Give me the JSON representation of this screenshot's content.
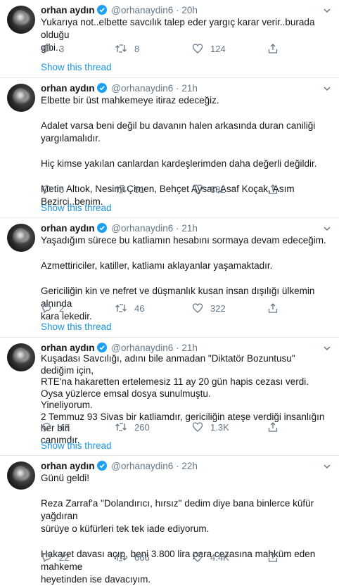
{
  "tweets": [
    {
      "name": "orhan aydın",
      "handle": "@orhanaydin6",
      "time": "20h",
      "lines": [
        "Yukarıya not..elbette savcılık talep eder yargıç karar verir..burada olduğu",
        "gibi.."
      ],
      "replies": "3",
      "retweets": "8",
      "likes": "124",
      "show_thread": "Show this thread"
    },
    {
      "name": "orhan aydın",
      "handle": "@orhanaydin6",
      "time": "21h",
      "lines": [
        "Elbette bir üst mahkemeye itiraz edeceğiz.",
        "",
        "Adalet varsa beni değil bu davanın halen arkasında duran caniliği",
        "yargılamalıdır.",
        "",
        "Hiç kimse yakılan canlardan kardeşlerimden daha değerli değildir.",
        "",
        "Metin Altıok, Nesimi Çimen, Behçet Aysan,Asaf Koçak, Asım Bezirci..benim."
      ],
      "replies": "6",
      "retweets": "51",
      "likes": "382",
      "show_thread": "Show this thread"
    },
    {
      "name": "orhan aydın",
      "handle": "@orhanaydin6",
      "time": "21h",
      "lines": [
        "Yaşadığım sürece bu katliamın hesabını sormaya devam edeceğim.",
        "",
        "Azmettiriciler, katiller, katliamı aklayanlar yaşamaktadır.",
        "",
        "Gericiliğin kin ve nefret ve düşmanlık kusan insan dışılığı ülkemin alnında",
        "kara lekedir."
      ],
      "replies": "2",
      "retweets": "46",
      "likes": "322",
      "show_thread": "Show this thread"
    },
    {
      "name": "orhan aydın",
      "handle": "@orhanaydin6",
      "time": "21h",
      "lines": [
        "Kuşadası Savcılığı, adını bile anmadan \"Diktatör Bozuntusu\" dediğim için,",
        "RTE'na hakaretten ertelemesiz 11 ay 20 gün hapis cezası verdi.",
        "Oysa yüzlerce emsal dosya sunulmuştu.",
        "Yineliyorum.",
        "2 Temmuz 93 Sivas bir katliamdır, gericiliğin ateşe verdiği insanlığın her biri",
        "canımdır."
      ],
      "replies": "43",
      "retweets": "260",
      "likes": "1.3K",
      "show_thread": "Show this thread"
    },
    {
      "name": "orhan aydın",
      "handle": "@orhanaydin6",
      "time": "22h",
      "lines": [
        "Günü geldi!",
        "",
        "Reza Zarraf'a \"Dolandırıcı, hırsız\" dedim diye bana binlerce küfür yağdıran",
        "sürüye o küfürleri tek tek iade ediyorum.",
        "",
        "Hakaret davası açıp, beni 3.800 lira para cezasına mahküm eden mahkeme",
        "heyetinden ise davacıyım."
      ],
      "replies": "22",
      "retweets": "666",
      "likes": "4.4K",
      "show_thread": ""
    }
  ],
  "icons": {
    "reply": "reply-icon",
    "retweet": "retweet-icon",
    "like": "heart-icon",
    "share": "share-icon",
    "caret": "chevron-down-icon",
    "verified": "verified-badge-icon"
  },
  "colors": {
    "link": "#1b95e0",
    "verified": "#1da1f2",
    "muted": "#657786",
    "text": "#14171a",
    "separator": "#e6ecf0"
  }
}
